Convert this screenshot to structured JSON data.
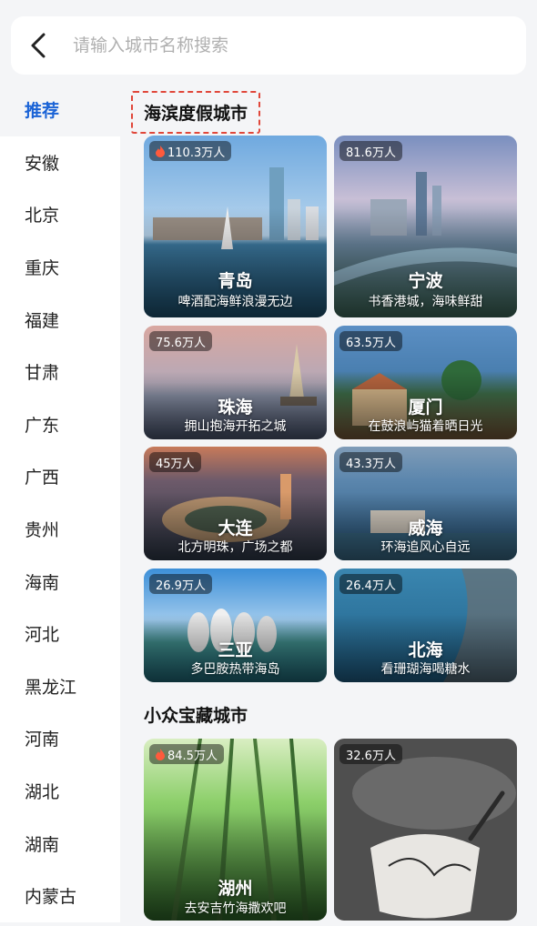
{
  "search": {
    "placeholder": "请输入城市名称搜索"
  },
  "sidebar": {
    "items": [
      {
        "label": "推荐",
        "active": true
      },
      {
        "label": "安徽"
      },
      {
        "label": "北京"
      },
      {
        "label": "重庆"
      },
      {
        "label": "福建"
      },
      {
        "label": "甘肃"
      },
      {
        "label": "广东"
      },
      {
        "label": "广西"
      },
      {
        "label": "贵州"
      },
      {
        "label": "海南"
      },
      {
        "label": "河北"
      },
      {
        "label": "黑龙江"
      },
      {
        "label": "河南"
      },
      {
        "label": "湖北"
      },
      {
        "label": "湖南"
      },
      {
        "label": "内蒙古"
      }
    ]
  },
  "sections": [
    {
      "title": "海滨度假城市",
      "cards": [
        {
          "name": "青岛",
          "slogan": "啤酒配海鲜浪漫无边",
          "visitors": "110.3万人",
          "hot": true
        },
        {
          "name": "宁波",
          "slogan": "书香港城，海味鲜甜",
          "visitors": "81.6万人",
          "hot": false
        },
        {
          "name": "珠海",
          "slogan": "拥山抱海开拓之城",
          "visitors": "75.6万人",
          "hot": false
        },
        {
          "name": "厦门",
          "slogan": "在鼓浪屿猫着晒日光",
          "visitors": "63.5万人",
          "hot": false
        },
        {
          "name": "大连",
          "slogan": "北方明珠，广场之都",
          "visitors": "45万人",
          "hot": false
        },
        {
          "name": "威海",
          "slogan": "环海追风心自远",
          "visitors": "43.3万人",
          "hot": false
        },
        {
          "name": "三亚",
          "slogan": "多巴胺热带海岛",
          "visitors": "26.9万人",
          "hot": false
        },
        {
          "name": "北海",
          "slogan": "看珊瑚海喝糖水",
          "visitors": "26.4万人",
          "hot": false
        }
      ]
    },
    {
      "title": "小众宝藏城市",
      "cards": [
        {
          "name": "湖州",
          "slogan": "去安吉竹海撒欢吧",
          "visitors": "84.5万人",
          "hot": true
        },
        {
          "name": "",
          "slogan": "",
          "visitors": "32.6万人",
          "hot": false
        }
      ]
    }
  ],
  "colors": {
    "accent": "#1a63d6",
    "highlight_border": "#e0473a",
    "hot": "#ff5a3c"
  }
}
